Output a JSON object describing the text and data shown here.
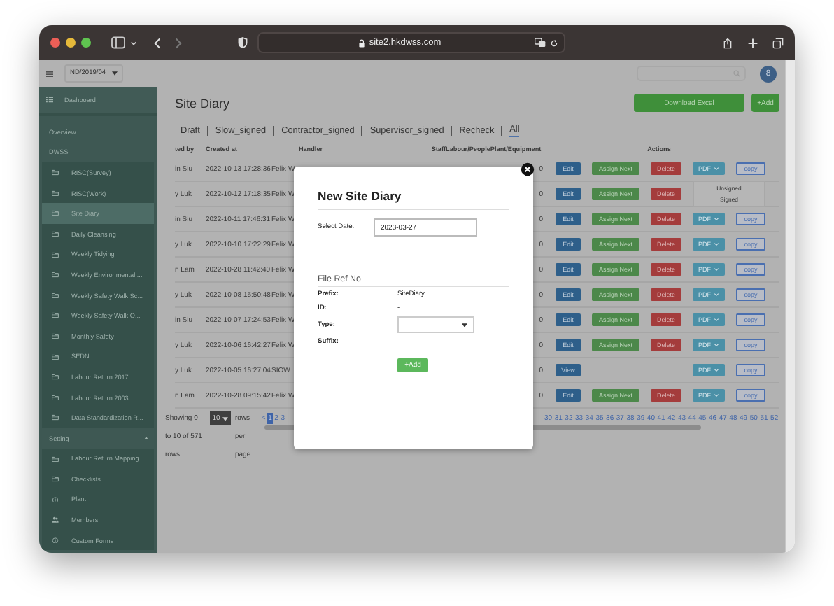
{
  "browser": {
    "url": "site2.hkdwss.com",
    "back_enabled": true,
    "forward_enabled": false
  },
  "topbar": {
    "project": "ND/2019/04",
    "avatar": "8"
  },
  "sidebar": {
    "header": "Dashboard",
    "items": [
      {
        "label": "Overview",
        "kind": "link",
        "selected": false
      },
      {
        "label": "DWSS",
        "kind": "section",
        "children": [
          {
            "label": "RISC(Survey)",
            "kind": "folder",
            "selected": false
          },
          {
            "label": "RISC(Work)",
            "kind": "folder",
            "selected": false
          },
          {
            "label": "Site Diary",
            "kind": "folder",
            "selected": true
          },
          {
            "label": "Daily Cleansing",
            "kind": "folder",
            "selected": false
          },
          {
            "label": "Weekly Tidying",
            "kind": "folder",
            "selected": false
          },
          {
            "label": "Weekly Environmental ...",
            "kind": "folder",
            "selected": false
          },
          {
            "label": "Weekly Safety Walk Sc...",
            "kind": "folder",
            "selected": false
          },
          {
            "label": "Weekly Safety Walk O...",
            "kind": "folder",
            "selected": false
          },
          {
            "label": "Monthly Safety",
            "kind": "folder",
            "selected": false
          },
          {
            "label": "SEDN",
            "kind": "folder",
            "selected": false
          },
          {
            "label": "Labour Return 2017",
            "kind": "folder",
            "selected": false
          },
          {
            "label": "Labour Return 2003",
            "kind": "folder",
            "selected": false
          },
          {
            "label": "Data Standardization R...",
            "kind": "folder",
            "selected": false
          }
        ]
      },
      {
        "label": "Setting",
        "kind": "section",
        "expanded": true,
        "children": [
          {
            "label": "Labour Return Mapping",
            "kind": "folder",
            "selected": false
          },
          {
            "label": "Checklists",
            "kind": "folder",
            "selected": false
          },
          {
            "label": "Plant",
            "kind": "info",
            "selected": false
          },
          {
            "label": "Members",
            "kind": "people",
            "selected": false
          },
          {
            "label": "Custom Forms",
            "kind": "info",
            "selected": false
          }
        ]
      }
    ]
  },
  "main": {
    "title": "Site Diary",
    "buttons": [
      "Download Excel",
      "+Add"
    ],
    "tabs": [
      {
        "label": "Draft",
        "selected": false
      },
      {
        "label": "Slow_signed",
        "selected": false
      },
      {
        "label": "Contractor_signed",
        "selected": false
      },
      {
        "label": "Supervisor_signed",
        "selected": false
      },
      {
        "label": "Recheck",
        "selected": false
      },
      {
        "label": "All",
        "selected": true
      }
    ],
    "table": {
      "columns": [
        "ted by",
        "Created at",
        "Handler",
        "StaffLabour/PeoplePlant/Equipment",
        "Actions"
      ],
      "rows": [
        {
          "created_by": "in Siu",
          "created_at": "2022-10-13 17:28:36",
          "handler": "Felix W",
          "staff": "0",
          "actions": [
            {
              "kind": "edit",
              "label": "Edit"
            },
            {
              "kind": "assign",
              "label": "Assign Next"
            },
            {
              "kind": "delete",
              "label": "Delete"
            },
            {
              "kind": "pdf",
              "label": "PDF"
            },
            {
              "kind": "copy",
              "label": "copy"
            }
          ]
        },
        {
          "created_by": "y Luk",
          "created_at": "2022-10-12 17:18:35",
          "handler": "Felix W",
          "staff": "0",
          "actions": [
            {
              "kind": "edit",
              "label": "Edit"
            },
            {
              "kind": "assign",
              "label": "Assign Next"
            },
            {
              "kind": "delete",
              "label": "Delete"
            },
            {
              "kind": "menu",
              "items": [
                "Unsigned",
                "Signed"
              ]
            }
          ]
        },
        {
          "created_by": "in Siu",
          "created_at": "2022-10-11 17:46:31",
          "handler": "Felix W",
          "staff": "0",
          "actions": [
            {
              "kind": "edit",
              "label": "Edit"
            },
            {
              "kind": "assign",
              "label": "Assign Next"
            },
            {
              "kind": "delete",
              "label": "Delete"
            },
            {
              "kind": "pdf",
              "label": "PDF"
            },
            {
              "kind": "copy",
              "label": "copy"
            }
          ]
        },
        {
          "created_by": "y Luk",
          "created_at": "2022-10-10 17:22:29",
          "handler": "Felix W",
          "staff": "0",
          "actions": [
            {
              "kind": "edit",
              "label": "Edit"
            },
            {
              "kind": "assign",
              "label": "Assign Next"
            },
            {
              "kind": "delete",
              "label": "Delete"
            },
            {
              "kind": "pdf",
              "label": "PDF"
            },
            {
              "kind": "copy",
              "label": "copy"
            }
          ]
        },
        {
          "created_by": "n Lam",
          "created_at": "2022-10-28 11:42:40",
          "handler": "Felix W",
          "staff": "0",
          "actions": [
            {
              "kind": "edit",
              "label": "Edit"
            },
            {
              "kind": "assign",
              "label": "Assign Next"
            },
            {
              "kind": "delete",
              "label": "Delete"
            },
            {
              "kind": "pdf",
              "label": "PDF"
            },
            {
              "kind": "copy",
              "label": "copy"
            }
          ]
        },
        {
          "created_by": "y Luk",
          "created_at": "2022-10-08 15:50:48",
          "handler": "Felix W",
          "staff": "0",
          "actions": [
            {
              "kind": "edit",
              "label": "Edit"
            },
            {
              "kind": "assign",
              "label": "Assign Next"
            },
            {
              "kind": "delete",
              "label": "Delete"
            },
            {
              "kind": "pdf",
              "label": "PDF"
            },
            {
              "kind": "copy",
              "label": "copy"
            }
          ]
        },
        {
          "created_by": "in Siu",
          "created_at": "2022-10-07 17:24:53",
          "handler": "Felix W",
          "staff": "0",
          "actions": [
            {
              "kind": "edit",
              "label": "Edit"
            },
            {
              "kind": "assign",
              "label": "Assign Next"
            },
            {
              "kind": "delete",
              "label": "Delete"
            },
            {
              "kind": "pdf",
              "label": "PDF"
            },
            {
              "kind": "copy",
              "label": "copy"
            }
          ]
        },
        {
          "created_by": "y Luk",
          "created_at": "2022-10-06 16:42:27",
          "handler": "Felix W",
          "staff": "0",
          "actions": [
            {
              "kind": "edit",
              "label": "Edit"
            },
            {
              "kind": "assign",
              "label": "Assign Next"
            },
            {
              "kind": "delete",
              "label": "Delete"
            },
            {
              "kind": "pdf",
              "label": "PDF"
            },
            {
              "kind": "copy",
              "label": "copy"
            }
          ]
        },
        {
          "created_by": "y Luk",
          "created_at": "2022-10-05 16:27:04",
          "handler": "SIOW",
          "staff": "0",
          "actions": [
            {
              "kind": "view",
              "label": "View"
            },
            {
              "kind": "pdf",
              "label": "PDF"
            },
            {
              "kind": "copy",
              "label": "copy"
            }
          ]
        },
        {
          "created_by": "n Lam",
          "created_at": "2022-10-28 09:15:42",
          "handler": "Felix W",
          "staff": "0",
          "actions": [
            {
              "kind": "edit",
              "label": "Edit"
            },
            {
              "kind": "assign",
              "label": "Assign Next"
            },
            {
              "kind": "delete",
              "label": "Delete"
            },
            {
              "kind": "pdf",
              "label": "PDF"
            },
            {
              "kind": "copy",
              "label": "copy"
            }
          ]
        }
      ]
    },
    "pagination": {
      "showing": "Showing 0 to 10 of 571 rows",
      "page_size": "10",
      "per_page_label": "rows per page",
      "pages_start": [
        {
          "label": "<",
          "selected": false
        },
        {
          "label": "1",
          "selected": true
        },
        {
          "label": "2",
          "selected": false
        },
        {
          "label": "3",
          "selected": false
        }
      ],
      "pages_end": [
        {
          "label": "30",
          "selected": false
        },
        {
          "label": "31",
          "selected": false
        },
        {
          "label": "32",
          "selected": false
        },
        {
          "label": "33",
          "selected": false
        },
        {
          "label": "34",
          "selected": false
        },
        {
          "label": "35",
          "selected": false
        },
        {
          "label": "36",
          "selected": false
        },
        {
          "label": "37",
          "selected": false
        },
        {
          "label": "38",
          "selected": false
        },
        {
          "label": "39",
          "selected": false
        },
        {
          "label": "40",
          "selected": false
        },
        {
          "label": "41",
          "selected": false
        },
        {
          "label": "42",
          "selected": false
        },
        {
          "label": "43",
          "selected": false
        },
        {
          "label": "44",
          "selected": false
        },
        {
          "label": "45",
          "selected": false
        },
        {
          "label": "46",
          "selected": false
        },
        {
          "label": "47",
          "selected": false
        },
        {
          "label": "48",
          "selected": false
        },
        {
          "label": "49",
          "selected": false
        },
        {
          "label": "50",
          "selected": false
        },
        {
          "label": "51",
          "selected": false
        },
        {
          "label": "52",
          "selected": false
        }
      ]
    }
  },
  "modal": {
    "title": "New Site Diary",
    "date_label": "Select Date:",
    "date_value": "2023-03-27",
    "section": "File Ref No",
    "fields": [
      {
        "label": "Prefix:",
        "kind": "text",
        "value": "SiteDiary"
      },
      {
        "label": "ID:",
        "kind": "text",
        "value": "-"
      },
      {
        "label": "Type:",
        "kind": "select"
      },
      {
        "label": "Suffix:",
        "kind": "text",
        "value": "-"
      }
    ],
    "add_button": "+Add"
  }
}
